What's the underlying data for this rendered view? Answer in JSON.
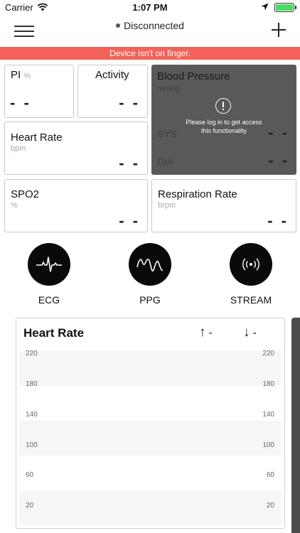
{
  "status_bar": {
    "carrier": "Carrier",
    "time": "1:07 PM"
  },
  "nav": {
    "connection_status": "Disconnected"
  },
  "alert": {
    "text": "Device isn't on finger."
  },
  "cards": {
    "pi": {
      "title": "PI",
      "unit": "%",
      "value": "- -"
    },
    "activity": {
      "title": "Activity",
      "value": "- -"
    },
    "blood_pressure": {
      "title": "Blood Pressure",
      "unit": "mmHg",
      "sys_label": "SYS",
      "sys_value": "- -",
      "dia_label": "DIA",
      "dia_value": "- -",
      "lock_message_line1": "Please log in to get access",
      "lock_message_line2": "this functionality"
    },
    "heart_rate": {
      "title": "Heart Rate",
      "unit": "bpm",
      "value": "- -"
    },
    "spo2": {
      "title": "SPO2",
      "unit": "%",
      "value": "- -"
    },
    "respiration_rate": {
      "title": "Respiration Rate",
      "unit": "brpm",
      "value": "- -"
    }
  },
  "actions": [
    {
      "label": "ECG",
      "icon": "ecg-waveform-icon"
    },
    {
      "label": "PPG",
      "icon": "ppg-waveform-icon"
    },
    {
      "label": "STREAM",
      "icon": "stream-broadcast-icon"
    }
  ],
  "chart": {
    "title": "Heart Rate",
    "max_arrow": "↑",
    "max_value": "-",
    "min_arrow": "↓",
    "min_value": "-",
    "y_ticks": [
      "220",
      "180",
      "140",
      "100",
      "60",
      "20"
    ]
  },
  "colors": {
    "alert_bg": "#f2625a",
    "locked_card_bg": "#595959",
    "battery_fill": "#4cd964",
    "round_button_bg": "#0a0a0a"
  }
}
